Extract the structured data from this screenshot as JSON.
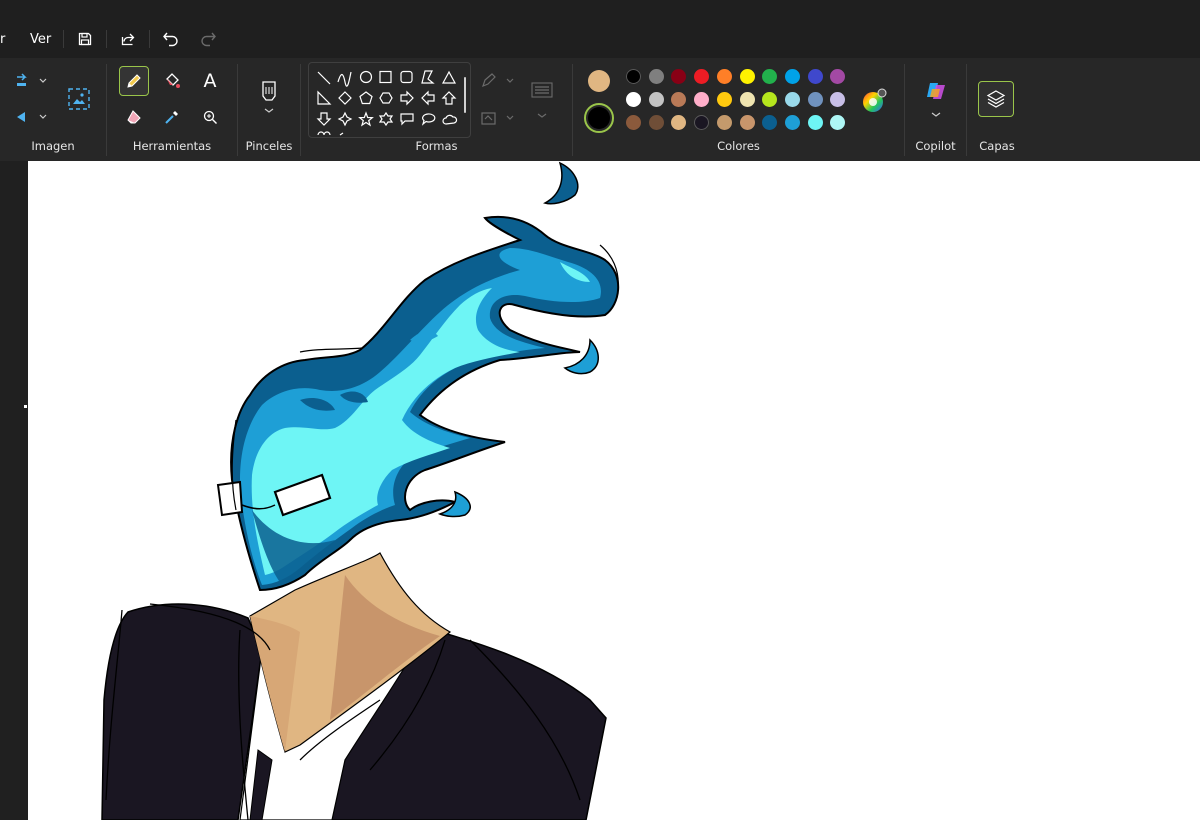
{
  "menubar": {
    "partial_menu_label": "r",
    "view_menu_label": "Ver",
    "icons": [
      "save-icon",
      "share-icon",
      "undo-icon",
      "redo-icon"
    ]
  },
  "ribbon": {
    "image_group": {
      "label": "Imagen",
      "icons": [
        "rotate-icon",
        "flip-icon",
        "select-image-icon"
      ]
    },
    "tools_group": {
      "label": "Herramientas",
      "icons": [
        "pencil-icon",
        "fill-icon",
        "text-icon",
        "eraser-icon",
        "color-picker-icon",
        "magnifier-icon"
      ],
      "text_tool_glyph": "A",
      "active_tool": "pencil"
    },
    "brushes_group": {
      "label": "Pinceles",
      "icons": [
        "brush-icon"
      ]
    },
    "shapes_group": {
      "label": "Formas",
      "shapes": [
        "line",
        "curve",
        "oval",
        "rectangle",
        "rounded-rectangle",
        "polygon",
        "triangle",
        "right-triangle",
        "diamond",
        "pentagon",
        "hexagon",
        "right-arrow",
        "left-arrow",
        "up-arrow",
        "down-arrow",
        "four-point-star",
        "five-point-star",
        "six-point-star",
        "rect-callout",
        "oval-callout",
        "cloud-callout"
      ],
      "outline_icon": "outline-icon",
      "fill_icon": "shape-fill-icon",
      "size_icon": "stroke-size-icon"
    },
    "colors_group": {
      "label": "Colores",
      "color1": "#e0b682",
      "color2": "#000000",
      "palette": [
        [
          "#000000",
          "#7f7f7f",
          "#880015",
          "#ed1c24",
          "#ff7f27",
          "#fff200",
          "#22b14c",
          "#00a2e8",
          "#3f48cc",
          "#a349a4"
        ],
        [
          "#ffffff",
          "#c3c3c3",
          "#b97a57",
          "#ffaec9",
          "#ffc90e",
          "#efe4b0",
          "#b5e61d",
          "#99d9ea",
          "#7092be",
          "#c8bfe7"
        ],
        [
          "#8b5a3c",
          "#6f4e37",
          "#e0b682",
          "#1a1622",
          "#c49a6c",
          "#c8956b",
          "#0b5f8f",
          "#1e9fd6",
          "#6ef5f5",
          "#aef7f5"
        ]
      ],
      "edit_colors_icon": "color-wheel-icon"
    },
    "copilot_group": {
      "label": "Copilot",
      "icons": [
        "copilot-icon"
      ]
    },
    "layers_group": {
      "label": "Capas",
      "icons": [
        "layers-icon"
      ]
    }
  },
  "canvas": {
    "background": "#ffffff",
    "artwork": "drawing-of-figure-with-blue-flame-head-in-black-suit"
  },
  "colors": {
    "accent": "#9ac54a",
    "flame_dark": "#0b5f8f",
    "flame_mid": "#1e9fd6",
    "flame_light": "#6ef5f5",
    "skin": "#e0b682",
    "skin_shade": "#c8956b",
    "suit": "#1a1622"
  }
}
